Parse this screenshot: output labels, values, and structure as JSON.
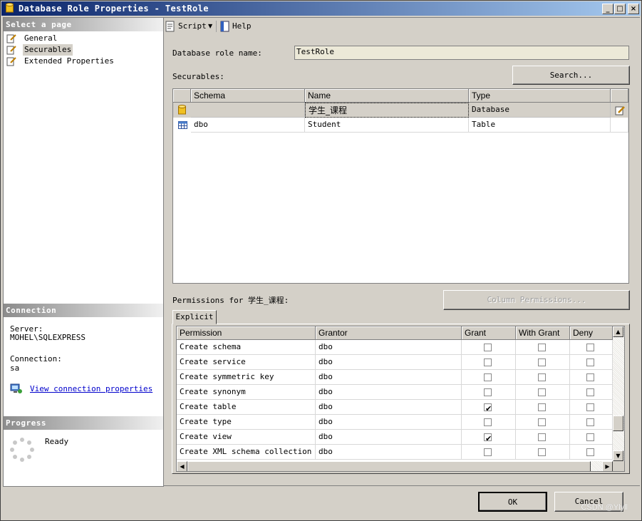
{
  "window": {
    "title": "Database Role Properties - TestRole"
  },
  "left": {
    "select_header": "Select a page",
    "pages": [
      {
        "label": "General"
      },
      {
        "label": "Securables"
      },
      {
        "label": "Extended Properties"
      }
    ],
    "connection_header": "Connection",
    "server_label": "Server:",
    "server_value": "MOHEL\\SQLEXPRESS",
    "connection_label": "Connection:",
    "connection_value": "sa",
    "view_connection_link": "View connection properties",
    "progress_header": "Progress",
    "progress_status": "Ready"
  },
  "toolbar": {
    "script_label": "Script",
    "help_label": "Help"
  },
  "role": {
    "name_label": "Database role name:",
    "name_value": "TestRole"
  },
  "securables": {
    "label": "Securables:",
    "search_button": "Search...",
    "columns": [
      "Schema",
      "Name",
      "Type"
    ],
    "rows": [
      {
        "schema": "",
        "name": "学生_课程",
        "type": "Database",
        "icon": "database-icon"
      },
      {
        "schema": "dbo",
        "name": "Student",
        "type": "Table",
        "icon": "table-icon"
      }
    ]
  },
  "permissions": {
    "label": "Permissions for 学生_课程:",
    "column_permissions_button": "Column Permissions...",
    "tab_explicit": "Explicit",
    "columns": [
      "Permission",
      "Grantor",
      "Grant",
      "With Grant",
      "Deny"
    ],
    "rows": [
      {
        "permission": "Create schema",
        "grantor": "dbo",
        "grant": false,
        "with_grant": false,
        "deny": false
      },
      {
        "permission": "Create service",
        "grantor": "dbo",
        "grant": false,
        "with_grant": false,
        "deny": false
      },
      {
        "permission": "Create symmetric key",
        "grantor": "dbo",
        "grant": false,
        "with_grant": false,
        "deny": false
      },
      {
        "permission": "Create synonym",
        "grantor": "dbo",
        "grant": false,
        "with_grant": false,
        "deny": false
      },
      {
        "permission": "Create table",
        "grantor": "dbo",
        "grant": true,
        "with_grant": false,
        "deny": false
      },
      {
        "permission": "Create type",
        "grantor": "dbo",
        "grant": false,
        "with_grant": false,
        "deny": false
      },
      {
        "permission": "Create view",
        "grantor": "dbo",
        "grant": true,
        "with_grant": false,
        "deny": false
      },
      {
        "permission": "Create XML schema collection",
        "grantor": "dbo",
        "grant": false,
        "with_grant": false,
        "deny": false
      }
    ]
  },
  "buttons": {
    "ok": "OK",
    "cancel": "Cancel"
  },
  "watermark": "CSDN @Ylyll",
  "colors": {
    "title_start": "#0a246a",
    "title_end": "#a6caf0",
    "face": "#d4d0c8",
    "link": "#0000cc"
  }
}
